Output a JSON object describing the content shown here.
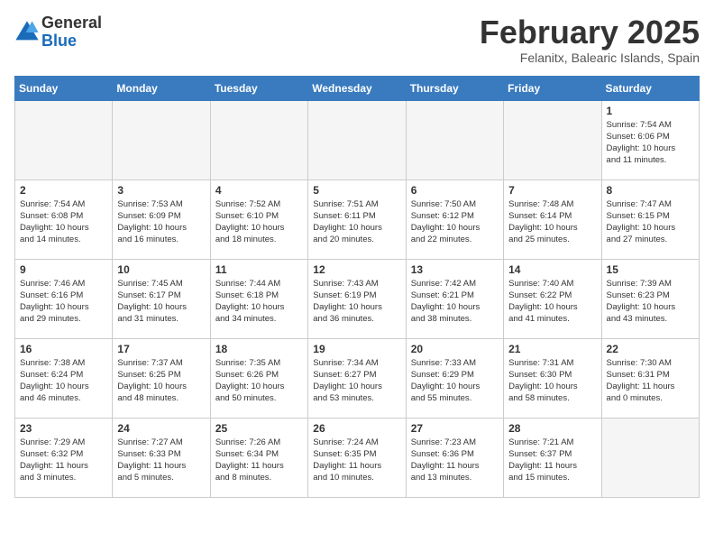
{
  "header": {
    "logo_general": "General",
    "logo_blue": "Blue",
    "month_title": "February 2025",
    "location": "Felanitx, Balearic Islands, Spain"
  },
  "days_of_week": [
    "Sunday",
    "Monday",
    "Tuesday",
    "Wednesday",
    "Thursday",
    "Friday",
    "Saturday"
  ],
  "weeks": [
    [
      {
        "day": "",
        "info": ""
      },
      {
        "day": "",
        "info": ""
      },
      {
        "day": "",
        "info": ""
      },
      {
        "day": "",
        "info": ""
      },
      {
        "day": "",
        "info": ""
      },
      {
        "day": "",
        "info": ""
      },
      {
        "day": "1",
        "info": "Sunrise: 7:54 AM\nSunset: 6:06 PM\nDaylight: 10 hours\nand 11 minutes."
      }
    ],
    [
      {
        "day": "2",
        "info": "Sunrise: 7:54 AM\nSunset: 6:08 PM\nDaylight: 10 hours\nand 14 minutes."
      },
      {
        "day": "3",
        "info": "Sunrise: 7:53 AM\nSunset: 6:09 PM\nDaylight: 10 hours\nand 16 minutes."
      },
      {
        "day": "4",
        "info": "Sunrise: 7:52 AM\nSunset: 6:10 PM\nDaylight: 10 hours\nand 18 minutes."
      },
      {
        "day": "5",
        "info": "Sunrise: 7:51 AM\nSunset: 6:11 PM\nDaylight: 10 hours\nand 20 minutes."
      },
      {
        "day": "6",
        "info": "Sunrise: 7:50 AM\nSunset: 6:12 PM\nDaylight: 10 hours\nand 22 minutes."
      },
      {
        "day": "7",
        "info": "Sunrise: 7:48 AM\nSunset: 6:14 PM\nDaylight: 10 hours\nand 25 minutes."
      },
      {
        "day": "8",
        "info": "Sunrise: 7:47 AM\nSunset: 6:15 PM\nDaylight: 10 hours\nand 27 minutes."
      }
    ],
    [
      {
        "day": "9",
        "info": "Sunrise: 7:46 AM\nSunset: 6:16 PM\nDaylight: 10 hours\nand 29 minutes."
      },
      {
        "day": "10",
        "info": "Sunrise: 7:45 AM\nSunset: 6:17 PM\nDaylight: 10 hours\nand 31 minutes."
      },
      {
        "day": "11",
        "info": "Sunrise: 7:44 AM\nSunset: 6:18 PM\nDaylight: 10 hours\nand 34 minutes."
      },
      {
        "day": "12",
        "info": "Sunrise: 7:43 AM\nSunset: 6:19 PM\nDaylight: 10 hours\nand 36 minutes."
      },
      {
        "day": "13",
        "info": "Sunrise: 7:42 AM\nSunset: 6:21 PM\nDaylight: 10 hours\nand 38 minutes."
      },
      {
        "day": "14",
        "info": "Sunrise: 7:40 AM\nSunset: 6:22 PM\nDaylight: 10 hours\nand 41 minutes."
      },
      {
        "day": "15",
        "info": "Sunrise: 7:39 AM\nSunset: 6:23 PM\nDaylight: 10 hours\nand 43 minutes."
      }
    ],
    [
      {
        "day": "16",
        "info": "Sunrise: 7:38 AM\nSunset: 6:24 PM\nDaylight: 10 hours\nand 46 minutes."
      },
      {
        "day": "17",
        "info": "Sunrise: 7:37 AM\nSunset: 6:25 PM\nDaylight: 10 hours\nand 48 minutes."
      },
      {
        "day": "18",
        "info": "Sunrise: 7:35 AM\nSunset: 6:26 PM\nDaylight: 10 hours\nand 50 minutes."
      },
      {
        "day": "19",
        "info": "Sunrise: 7:34 AM\nSunset: 6:27 PM\nDaylight: 10 hours\nand 53 minutes."
      },
      {
        "day": "20",
        "info": "Sunrise: 7:33 AM\nSunset: 6:29 PM\nDaylight: 10 hours\nand 55 minutes."
      },
      {
        "day": "21",
        "info": "Sunrise: 7:31 AM\nSunset: 6:30 PM\nDaylight: 10 hours\nand 58 minutes."
      },
      {
        "day": "22",
        "info": "Sunrise: 7:30 AM\nSunset: 6:31 PM\nDaylight: 11 hours\nand 0 minutes."
      }
    ],
    [
      {
        "day": "23",
        "info": "Sunrise: 7:29 AM\nSunset: 6:32 PM\nDaylight: 11 hours\nand 3 minutes."
      },
      {
        "day": "24",
        "info": "Sunrise: 7:27 AM\nSunset: 6:33 PM\nDaylight: 11 hours\nand 5 minutes."
      },
      {
        "day": "25",
        "info": "Sunrise: 7:26 AM\nSunset: 6:34 PM\nDaylight: 11 hours\nand 8 minutes."
      },
      {
        "day": "26",
        "info": "Sunrise: 7:24 AM\nSunset: 6:35 PM\nDaylight: 11 hours\nand 10 minutes."
      },
      {
        "day": "27",
        "info": "Sunrise: 7:23 AM\nSunset: 6:36 PM\nDaylight: 11 hours\nand 13 minutes."
      },
      {
        "day": "28",
        "info": "Sunrise: 7:21 AM\nSunset: 6:37 PM\nDaylight: 11 hours\nand 15 minutes."
      },
      {
        "day": "",
        "info": ""
      }
    ]
  ]
}
